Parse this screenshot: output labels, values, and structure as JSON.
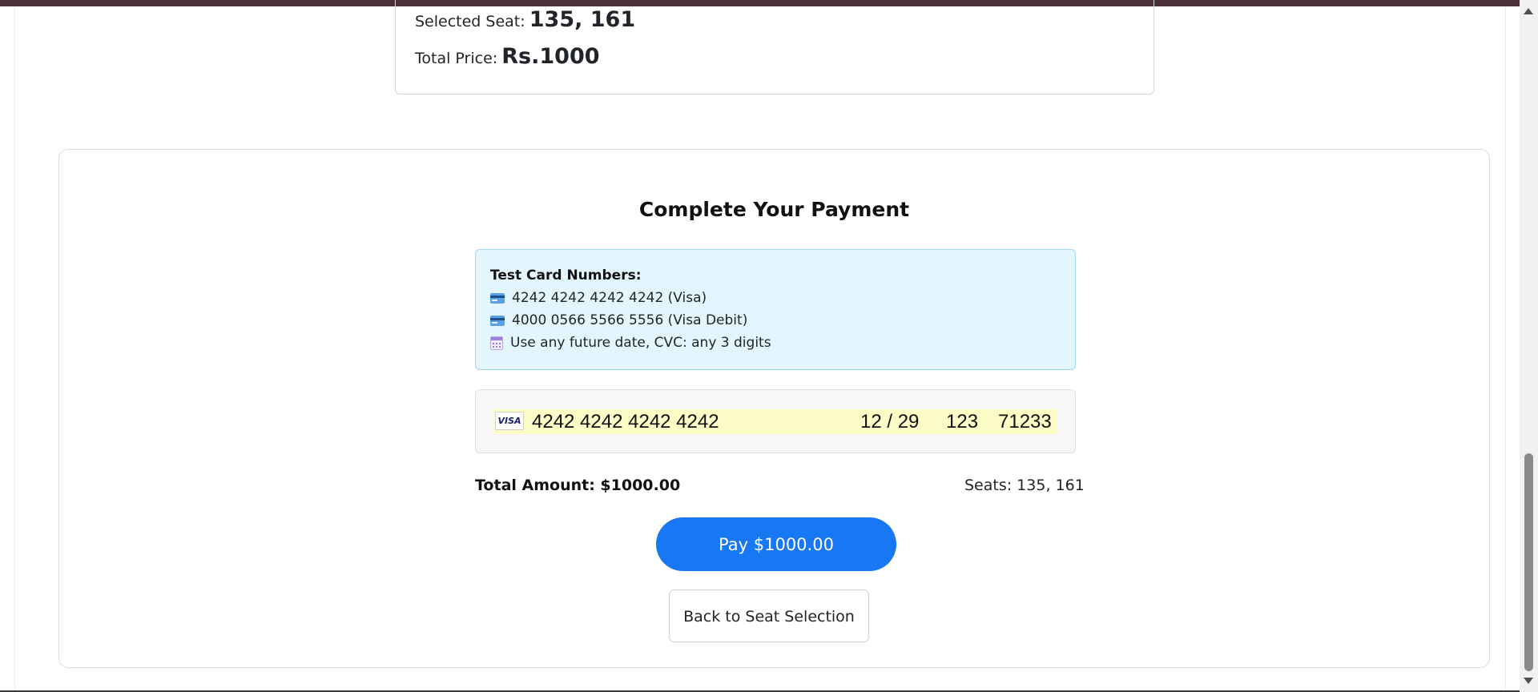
{
  "summary": {
    "seat_label": "Selected Seat:",
    "seat_value": "135, 161",
    "price_label": "Total Price:",
    "price_value": "Rs.1000"
  },
  "payment": {
    "title": "Complete Your Payment",
    "info": {
      "heading": "Test Card Numbers:",
      "lines": [
        {
          "icon": "credit-card-icon",
          "text": "4242 4242 4242 4242 (Visa)"
        },
        {
          "icon": "credit-card-icon",
          "text": "4000 0566 5566 5556 (Visa Debit)"
        },
        {
          "icon": "calendar-icon",
          "text": "Use any future date, CVC: any 3 digits"
        }
      ]
    },
    "card_form": {
      "brand": "VISA",
      "number": "4242 4242 4242 4242",
      "expiry": "12 / 29",
      "cvc": "123",
      "zip": "71233"
    },
    "total_amount": "Total Amount: $1000.00",
    "seats": "Seats: 135, 161",
    "pay_button": "Pay $1000.00",
    "back_button": "Back to Seat Selection"
  },
  "colors": {
    "primary_button": "#1877f2",
    "info_background": "#e4f6fd",
    "info_border": "#9fd9ee",
    "autofill_highlight": "#fcfcc6",
    "top_strip": "#4a3038"
  }
}
